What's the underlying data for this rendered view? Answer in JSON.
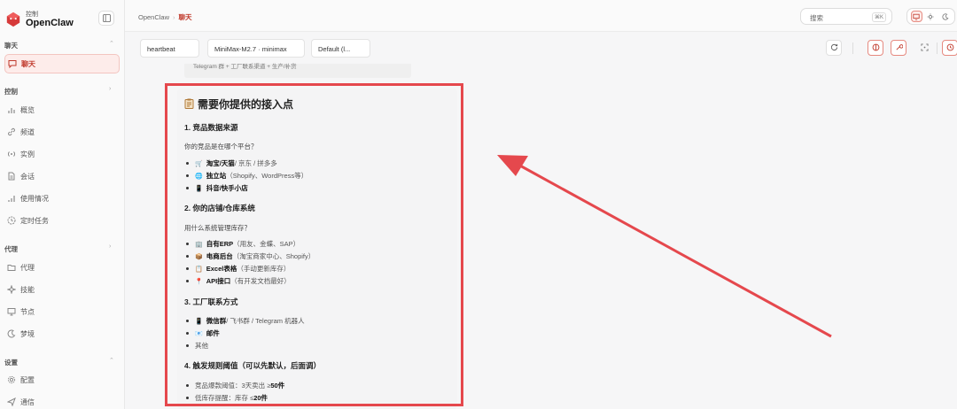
{
  "brand": {
    "sub": "控制",
    "name": "OpenClaw"
  },
  "sidebar": {
    "groups": [
      {
        "label": "聊天"
      },
      {
        "label": "控制"
      },
      {
        "label": "代理"
      },
      {
        "label": "设置"
      }
    ],
    "items": [
      {
        "label": "聊天",
        "icon": "chat-icon",
        "active": true
      },
      {
        "label": "概览",
        "icon": "chart-icon"
      },
      {
        "label": "频道",
        "icon": "link-icon"
      },
      {
        "label": "实例",
        "icon": "broadcast-icon"
      },
      {
        "label": "会话",
        "icon": "document-icon"
      },
      {
        "label": "使用情况",
        "icon": "bar-chart-icon"
      },
      {
        "label": "定时任务",
        "icon": "clock-icon"
      },
      {
        "label": "代理",
        "icon": "folder-icon"
      },
      {
        "label": "技能",
        "icon": "sparkle-icon"
      },
      {
        "label": "节点",
        "icon": "monitor-icon"
      },
      {
        "label": "梦境",
        "icon": "moon-icon"
      },
      {
        "label": "配置",
        "icon": "gear-icon"
      },
      {
        "label": "通信",
        "icon": "send-icon"
      }
    ]
  },
  "breadcrumb": {
    "root": "OpenClaw",
    "separator": "›",
    "current": "聊天"
  },
  "search": {
    "placeholder": "搜索",
    "shortcut": "⌘K"
  },
  "toolbar": {
    "session": "heartbeat",
    "model": "MiniMax-M2.7 · minimax",
    "preset": "Default (l..."
  },
  "prev_message": "Telegram 群 + 工厂联系渠道 + 生产/补货",
  "message": {
    "title": "需要你提供的接入点",
    "title_icon": "clipboard-icon",
    "sections": [
      {
        "heading": "1. 竞品数据来源",
        "desc": "你的竞品是在哪个平台？",
        "items": [
          {
            "icon": "🛒",
            "bold": "淘宝/天猫",
            "rest": " / 京东 / 拼多多"
          },
          {
            "icon": "🌐",
            "bold": "独立站",
            "rest": "（Shopify、WordPress等）"
          },
          {
            "icon": "📱",
            "bold": "抖音/快手小店",
            "rest": ""
          }
        ]
      },
      {
        "heading": "2. 你的店铺/仓库系统",
        "desc": "用什么系统管理库存？",
        "items": [
          {
            "icon": "🏢",
            "bold": "自有ERP",
            "rest": "（用友、金蝶、SAP）"
          },
          {
            "icon": "📦",
            "bold": "电商后台",
            "rest": "（淘宝商家中心、Shopify）"
          },
          {
            "icon": "📋",
            "bold": "Excel表格",
            "rest": "（手动更新库存）"
          },
          {
            "icon": "📍",
            "bold": "API接口",
            "rest": "（有开发文档最好）"
          }
        ]
      },
      {
        "heading": "3. 工厂联系方式",
        "desc": "",
        "items": [
          {
            "icon": "📱",
            "bold": "微信群",
            "rest": " / 飞书群 / Telegram 机器人"
          },
          {
            "icon": "📧",
            "bold": "邮件",
            "rest": ""
          },
          {
            "icon": "",
            "bold": "",
            "rest": "其他"
          }
        ]
      },
      {
        "heading": "4. 触发规则阈值（可以先默认，后面调）",
        "desc": "",
        "items": [
          {
            "icon": "",
            "bold": "",
            "rest": "竞品爆款阈值：3天卖出 ≥ ",
            "tail": "50件"
          },
          {
            "icon": "",
            "bold": "",
            "rest": "低库存提醒：库存 ≤ ",
            "tail": "20件"
          }
        ]
      }
    ]
  },
  "colors": {
    "accent": "#c0392b",
    "annotation": "#e5484d"
  }
}
